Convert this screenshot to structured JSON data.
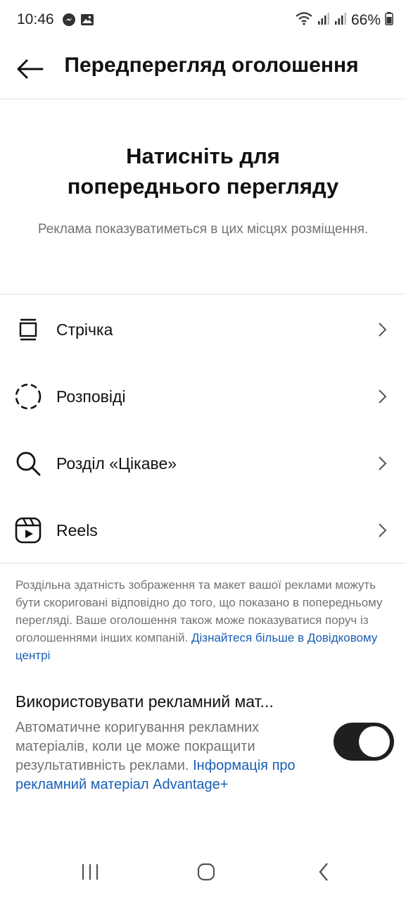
{
  "status_bar": {
    "time": "10:46",
    "battery": "66%"
  },
  "header": {
    "title": "Передперегляд оголошення"
  },
  "intro": {
    "heading_line1": "Натисніть для",
    "heading_line2": "попереднього перегляду",
    "subtitle": "Реклама показуватиметься в цих місцях розміщення."
  },
  "placements": [
    {
      "label": "Стрічка",
      "icon": "feed-icon"
    },
    {
      "label": "Розповіді",
      "icon": "stories-icon"
    },
    {
      "label": "Розділ «Цікаве»",
      "icon": "search-icon"
    },
    {
      "label": "Reels",
      "icon": "reels-icon"
    }
  ],
  "disclaimer": {
    "text": "Роздільна здатність зображення та макет вашої реклами можуть бути скориговані відповідно до того, що показано в попередньому перегляді. Ваше оголошення також може показуватися поруч із оголошеннями інших компаній.",
    "link": "Дізнайтеся більше в Довідковому центрі"
  },
  "advantage": {
    "title": "Використовувати рекламний мат...",
    "description": "Автоматичне коригування рекламних матеріалів, коли це може покращити результативність реклами.",
    "link": "Інформація про рекламний матеріал Advantage+",
    "toggle_on": true
  },
  "colors": {
    "accent_link": "#1a5fb4",
    "secondary_text": "#737373",
    "toggle_on": "#1f1f1f"
  }
}
